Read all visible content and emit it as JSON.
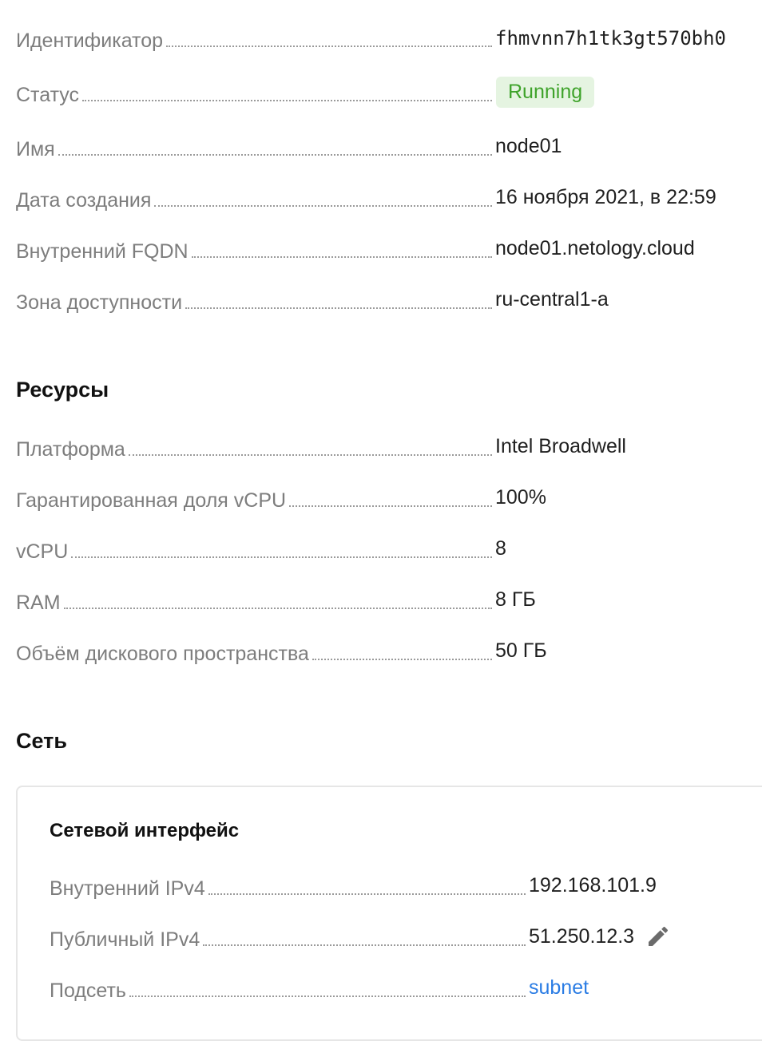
{
  "info": {
    "id": {
      "label": "Идентификатор",
      "value": "fhmvnn7h1tk3gt570bh0"
    },
    "status": {
      "label": "Статус",
      "value": "Running",
      "color": "#3fa32b",
      "bg": "#e5f4e1"
    },
    "name": {
      "label": "Имя",
      "value": "node01"
    },
    "created": {
      "label": "Дата создания",
      "value": "16 ноября 2021, в 22:59"
    },
    "fqdn": {
      "label": "Внутренний FQDN",
      "value": "node01.netology.cloud"
    },
    "zone": {
      "label": "Зона доступности",
      "value": "ru-central1-a"
    }
  },
  "resources": {
    "title": "Ресурсы",
    "platform": {
      "label": "Платформа",
      "value": "Intel Broadwell"
    },
    "vcpu_share": {
      "label": "Гарантированная доля vCPU",
      "value": "100%"
    },
    "vcpu": {
      "label": "vCPU",
      "value": "8"
    },
    "ram": {
      "label": "RAM",
      "value": "8 ГБ"
    },
    "disk": {
      "label": "Объём дискового пространства",
      "value": "50 ГБ"
    }
  },
  "network": {
    "title": "Сеть",
    "interface_title": "Сетевой интерфейс",
    "internal_ipv4": {
      "label": "Внутренний IPv4",
      "value": "192.168.101.9"
    },
    "public_ipv4": {
      "label": "Публичный IPv4",
      "value": "51.250.12.3",
      "edit_icon": "pencil-icon"
    },
    "subnet": {
      "label": "Подсеть",
      "value": "subnet",
      "link_color": "#2a7ce4"
    }
  }
}
